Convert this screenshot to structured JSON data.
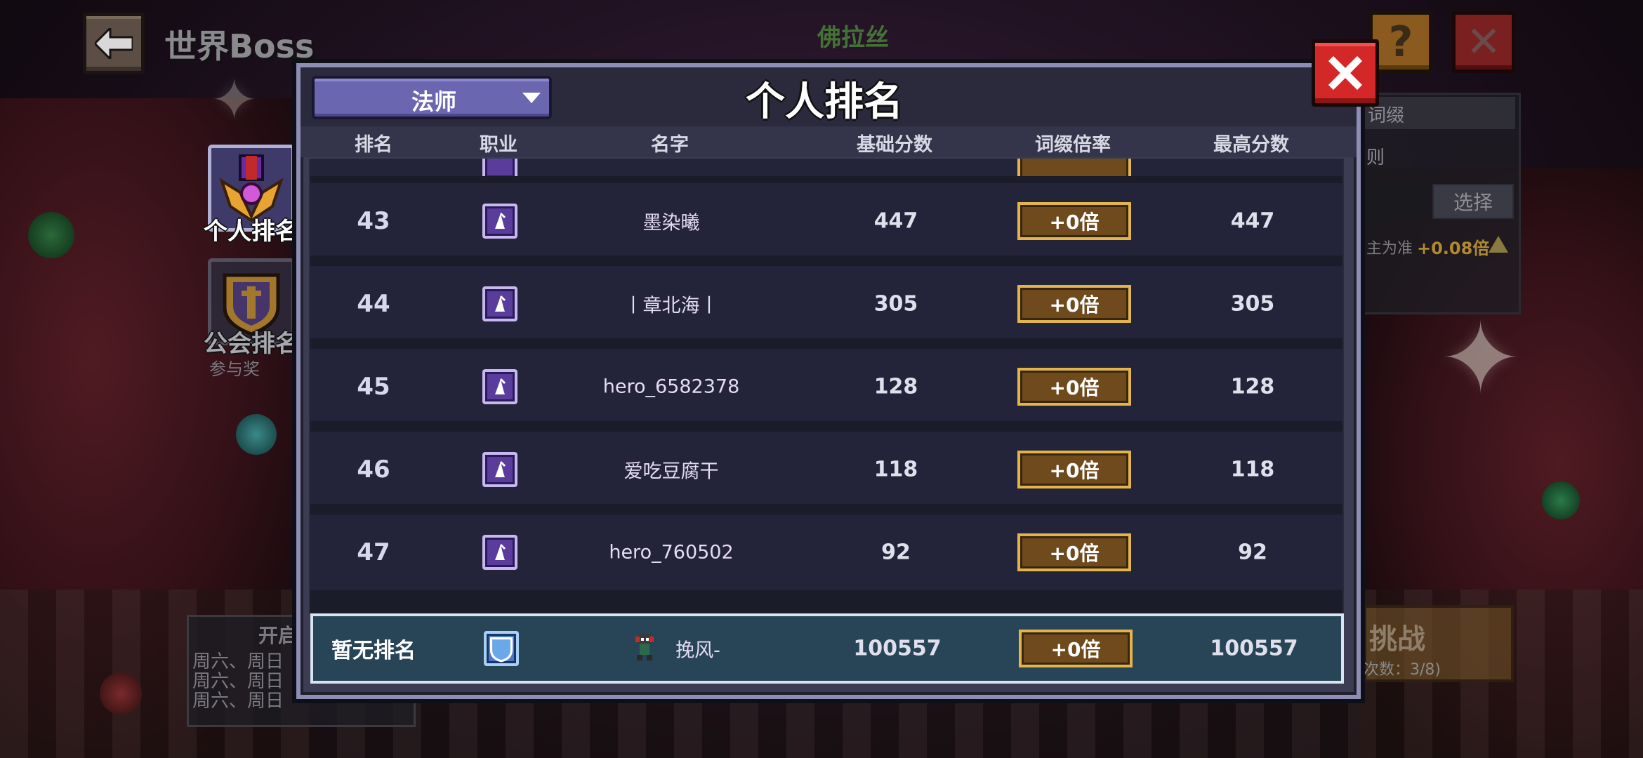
{
  "top_bar": {
    "title": "世界Boss",
    "boss_name": "佛拉丝"
  },
  "side_panel": {
    "suffix_label": "词缀",
    "select_label": "选择",
    "basis_text": "主为准",
    "bonus_text": "+0.08倍",
    "challenge_label": "挑战",
    "challenge_count": "次数：3/8)",
    "side_t": "则"
  },
  "schedule": {
    "title": "开启",
    "lines": [
      "周六、周日",
      "周六、周日",
      "周六、周日"
    ]
  },
  "tabs": {
    "personal_label": "个人排名",
    "guild_label": "公会排名",
    "participate_label": "参与奖"
  },
  "modal": {
    "title": "个人排名",
    "class_filter": "法师",
    "columns": {
      "rank": "排名",
      "class": "职业",
      "name": "名字",
      "base_score": "基础分数",
      "multiplier": "词缀倍率",
      "max_score": "最高分数"
    },
    "rows": [
      {
        "rank": "43",
        "class_icon": "mage-icon",
        "name": "墨染曦",
        "base_score": "447",
        "multiplier": "+0倍",
        "max_score": "447"
      },
      {
        "rank": "44",
        "class_icon": "mage-icon",
        "name": "丨章北海丨",
        "base_score": "305",
        "multiplier": "+0倍",
        "max_score": "305"
      },
      {
        "rank": "45",
        "class_icon": "mage-icon",
        "name": "hero_6582378",
        "base_score": "128",
        "multiplier": "+0倍",
        "max_score": "128"
      },
      {
        "rank": "46",
        "class_icon": "mage-icon",
        "name": "爱吃豆腐干",
        "base_score": "118",
        "multiplier": "+0倍",
        "max_score": "118"
      },
      {
        "rank": "47",
        "class_icon": "mage-icon",
        "name": "hero_760502",
        "base_score": "92",
        "multiplier": "+0倍",
        "max_score": "92"
      }
    ],
    "self_row": {
      "rank": "暂无排名",
      "class_icon": "shield-class-icon",
      "name": "挽风-",
      "base_score": "100557",
      "multiplier": "+0倍",
      "max_score": "100557"
    }
  },
  "colors": {
    "modal_bg": "#3c3c52",
    "row_bg": "#23243a",
    "self_row_bg": "#284558",
    "multiplier_gold": "#e2b44a",
    "close_red": "#d42828"
  }
}
